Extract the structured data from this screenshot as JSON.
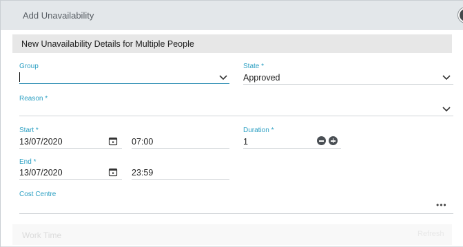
{
  "dialog": {
    "title": "Add Unavailability",
    "section_title": "New Unavailability Details for Multiple People"
  },
  "form": {
    "group": {
      "label": "Group",
      "value": ""
    },
    "state": {
      "label": "State",
      "required_mark": "*",
      "value": "Approved"
    },
    "reason": {
      "label": "Reason",
      "required_mark": "*",
      "value": ""
    },
    "start": {
      "label": "Start",
      "required_mark": "*",
      "date": "13/07/2020",
      "time": "07:00"
    },
    "duration": {
      "label": "Duration",
      "required_mark": "*",
      "value": "1"
    },
    "end": {
      "label": "End",
      "required_mark": "*",
      "date": "13/07/2020",
      "time": "23:59"
    },
    "cost_centre": {
      "label": "Cost Centre",
      "value": "",
      "more": "•••"
    }
  },
  "work_time": {
    "title": "Work Time",
    "refresh_label": "Refresh"
  },
  "colors": {
    "accent": "#2b9fc2",
    "header_bg": "#e3e7ea",
    "section_bg": "#e7e7e7"
  }
}
